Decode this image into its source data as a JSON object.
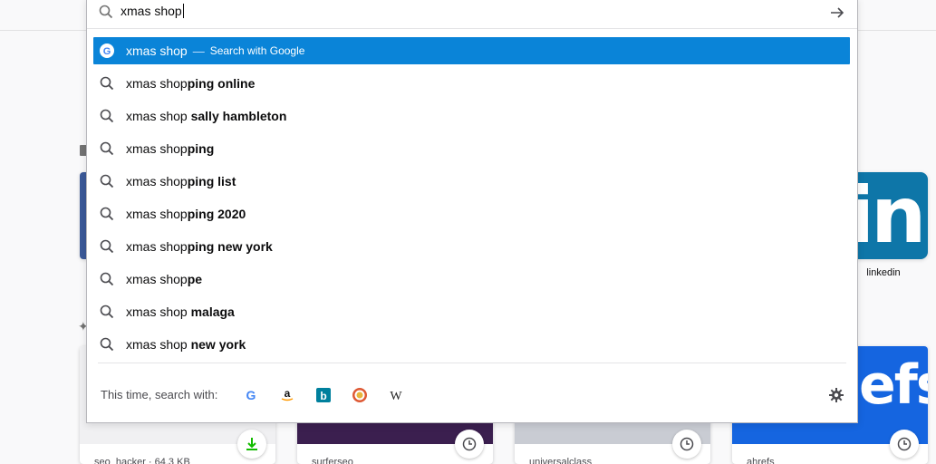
{
  "url_bar": {
    "typed_text": "xmas shop",
    "go_label": "→"
  },
  "suggestions": {
    "first": {
      "query": "xmas shop",
      "separator": "—",
      "action": "Search with Google"
    },
    "items": [
      {
        "base": "xmas shop",
        "completion": "ping online"
      },
      {
        "base": "xmas shop",
        "completion": " sally hambleton"
      },
      {
        "base": "xmas shop",
        "completion": "ping"
      },
      {
        "base": "xmas shop",
        "completion": "ping list"
      },
      {
        "base": "xmas shop",
        "completion": "ping 2020"
      },
      {
        "base": "xmas shop",
        "completion": "ping new york"
      },
      {
        "base": "xmas shop",
        "completion": "pe"
      },
      {
        "base": "xmas shop",
        "completion": " malaga"
      },
      {
        "base": "xmas shop",
        "completion": " new york"
      }
    ]
  },
  "one_off": {
    "label": "This time, search with:",
    "engines": [
      "google-icon",
      "amazon-icon",
      "bing-icon",
      "duckduckgo-icon",
      "wikipedia-icon"
    ]
  },
  "background": {
    "top_sites": [
      {
        "label": "linkedin",
        "text": "in"
      }
    ],
    "highlights": [
      {
        "caption": "seo_hacker · 64.3 KB"
      },
      {
        "caption": "surferseo"
      },
      {
        "caption": "universalclass"
      },
      {
        "caption": "ahrefs",
        "thumb_text": "efs"
      }
    ]
  },
  "colors": {
    "selection": "#0a84d8",
    "linkedin": "#0e76a8",
    "ahrefs": "#1565e0",
    "download": "#12bc00"
  }
}
